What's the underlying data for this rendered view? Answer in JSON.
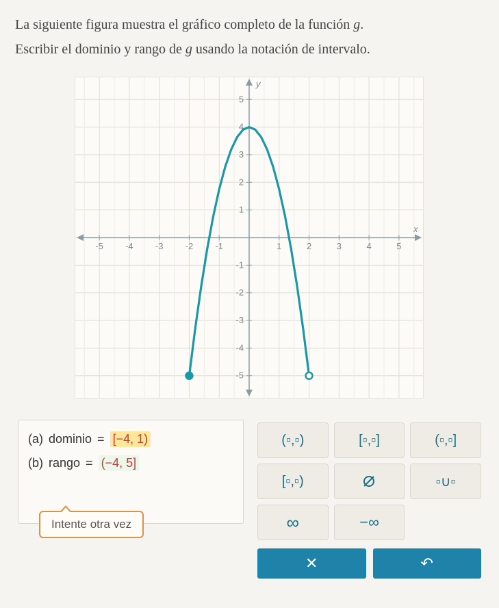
{
  "question": {
    "line1_a": "La siguiente figura muestra el gráfico completo de la función ",
    "line1_fn": "g",
    "line1_b": ".",
    "line2_a": "Escribir el dominio y rango de ",
    "line2_fn": "g",
    "line2_b": " usando la notación de intervalo."
  },
  "chart_data": {
    "type": "line",
    "title": "",
    "xlabel": "x",
    "ylabel": "y",
    "xlim": [
      -5.8,
      5.8
    ],
    "ylim": [
      -5.8,
      5.8
    ],
    "xticks": [
      -5,
      -4,
      -3,
      -2,
      -1,
      1,
      2,
      3,
      4,
      5
    ],
    "yticks": [
      -5,
      -4,
      -3,
      -2,
      -1,
      1,
      2,
      3,
      4,
      5
    ],
    "series": [
      {
        "name": "g",
        "color": "#1c97a7",
        "endpoints": {
          "left": {
            "x": -2,
            "y": -5,
            "closed": true
          },
          "right": {
            "x": 2,
            "y": -5,
            "closed": false
          }
        },
        "points": [
          {
            "x": -2.0,
            "y": -5.0
          },
          {
            "x": -1.8,
            "y": -3.29
          },
          {
            "x": -1.6,
            "y": -1.76
          },
          {
            "x": -1.4,
            "y": -0.41
          },
          {
            "x": -1.2,
            "y": 0.76
          },
          {
            "x": -1.0,
            "y": 1.75
          },
          {
            "x": -0.8,
            "y": 2.56
          },
          {
            "x": -0.6,
            "y": 3.19
          },
          {
            "x": -0.4,
            "y": 3.64
          },
          {
            "x": -0.2,
            "y": 3.91
          },
          {
            "x": 0.0,
            "y": 4.0
          },
          {
            "x": 0.2,
            "y": 3.91
          },
          {
            "x": 0.4,
            "y": 3.64
          },
          {
            "x": 0.6,
            "y": 3.19
          },
          {
            "x": 0.8,
            "y": 2.56
          },
          {
            "x": 1.0,
            "y": 1.75
          },
          {
            "x": 1.2,
            "y": 0.76
          },
          {
            "x": 1.4,
            "y": -0.41
          },
          {
            "x": 1.6,
            "y": -1.76
          },
          {
            "x": 1.8,
            "y": -3.29
          },
          {
            "x": 2.0,
            "y": -5.0
          }
        ]
      }
    ]
  },
  "answers": {
    "a_part": "(a)",
    "a_label": "dominio",
    "a_eq": "=",
    "a_value": "[−4, 1)",
    "b_part": "(b)",
    "b_label": "rango",
    "b_eq": "=",
    "b_value": "(−4, 5]"
  },
  "feedback": "Intente otra vez",
  "keypad": {
    "open_open": "(▫,▫)",
    "closed_closed": "[▫,▫]",
    "open_closed": "(▫,▫]",
    "closed_open": "[▫,▫)",
    "empty_set": "∅",
    "union": "▫∪▫",
    "infinity": "∞",
    "neg_infinity": "−∞"
  },
  "actions": {
    "clear": "✕",
    "undo": "↶"
  }
}
